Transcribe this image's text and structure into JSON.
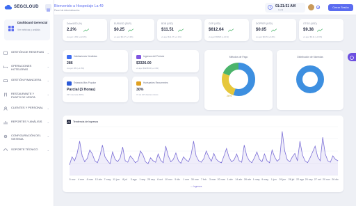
{
  "brand": {
    "name": "SEGCLOUD"
  },
  "sidebar": {
    "dashboard": {
      "title": "Dashboard Gerencial",
      "subtitle": "Ver métricas y análisis"
    },
    "items": [
      {
        "label": "GESTIÓN DE RESERVAS"
      },
      {
        "label": "OPERACIONES HOTELERAS"
      },
      {
        "label": "GESTIÓN FINANCIERA"
      },
      {
        "label": "RESTAURANTE Y PUNTO DE VENTA"
      },
      {
        "label": "CLIENTES Y PERSONAL"
      },
      {
        "label": "REPORTES Y ANÁLISIS"
      },
      {
        "label": "CONFIGURACIÓN DEL SISTEMA"
      },
      {
        "label": "SOPORTE TÉCNICO"
      }
    ]
  },
  "header": {
    "welcome": "Bienvenido a Hospedaje La 49",
    "subtitle": "Panel de Administración",
    "time": "01:21:51 AM",
    "timezone": "Local",
    "logout_label": "Cerrar Sesión"
  },
  "currency_cards": [
    {
      "label": "Dólar/USD (%)",
      "value": "2.2%",
      "sub": "vs ayer 1.8% (+22.2%)"
    },
    {
      "label": "EUR/USD (EUR)",
      "value": "$0.25",
      "sub": "vs ayer $0.27 (+7.4%)"
    },
    {
      "label": "BOB (USD)",
      "value": "$11.51",
      "sub": "vs ayer $11.27 (+2.1%)"
    },
    {
      "label": "COP (USD)",
      "value": "$612.64",
      "sub": "vs ayer $599.8 (+2.1%)"
    },
    {
      "label": "DOPPER (USD)",
      "value": "$0.05",
      "sub": "vs ayer $0.05 (+3.2%)"
    },
    {
      "label": "OTGO (USD)",
      "value": "$9.38",
      "sub": "vs ayer $9.11 (+3.0%)"
    }
  ],
  "kpis": [
    {
      "label": "Habitaciones Vendidas",
      "value": "286",
      "sub": "vs ayer 281 (+1.8%)",
      "color": "#3d6cf0"
    },
    {
      "label": "Ingresos del Periodo",
      "value": "$3326.00",
      "sub": "vs ayer $3248.00 (+2.4%)",
      "color": "#7f55e0"
    },
    {
      "label": "Estancia Más Popular",
      "value": "Parcial (3 Horas)",
      "sub": "197 reservas (69%)",
      "color": "#2c5bd8"
    },
    {
      "label": "Huéspedes Recurrentes",
      "value": "30%",
      "sub": "74 de 247 clientes únicos",
      "color": "#e0a020"
    }
  ],
  "donut_payment": {
    "title": "Métodos de Pago",
    "label": "26%",
    "segments": [
      {
        "name": "A",
        "value": 55,
        "color": "#3d8fe0"
      },
      {
        "name": "B",
        "value": 26,
        "color": "#e6c73a"
      },
      {
        "name": "C",
        "value": 19,
        "color": "#4bb46b"
      }
    ]
  },
  "donut_currency": {
    "title": "Distribución de Monedas",
    "segments": [
      {
        "name": "A",
        "value": 100,
        "color": "#3d8fe0"
      }
    ]
  },
  "chart_data": {
    "type": "line",
    "title": "Tendencia de Ingresos",
    "x": [
      "3 nov",
      "7 nov",
      "11 nov",
      "15 nov",
      "19 nov",
      "23 nov",
      "27 nov",
      "1 dic",
      "5 dic",
      "9 dic",
      "13 dic",
      "17 dic",
      "21 dic",
      "25 dic",
      "29 dic",
      "2 ene",
      "6 ene",
      "10 ene",
      "14 ene",
      "18 ene",
      "22 ene",
      "26 ene",
      "30 ene",
      "3 feb",
      "7 feb",
      "11 feb",
      "15 feb",
      "19 feb",
      "23 feb",
      "27 feb",
      "3 mar",
      "7 mar",
      "11 mar",
      "15 mar",
      "19 mar",
      "23 mar",
      "27 mar",
      "31 mar",
      "4 abr",
      "8 abr",
      "12 abr",
      "16 abr",
      "20 abr",
      "24 abr",
      "28 abr",
      "2 may",
      "6 may",
      "10 may",
      "14 may",
      "18 may",
      "22 may",
      "26 may",
      "30 may",
      "3 jun",
      "7 jun",
      "11 jun",
      "15 jun",
      "19 jun",
      "23 jun",
      "27 jun",
      "1 jul",
      "5 jul",
      "9 jul",
      "13 jul",
      "17 jul",
      "21 jul",
      "25 jul",
      "29 jul",
      "2 ago",
      "6 ago",
      "10 ago",
      "14 ago",
      "18 ago",
      "22 ago",
      "26 ago",
      "30 ago",
      "3 sep",
      "7 sep",
      "11 sep",
      "15 sep",
      "19 sep",
      "23 sep",
      "27 sep",
      "1 oct",
      "5 oct",
      "9 oct",
      "13 oct",
      "17 oct",
      "21 oct",
      "25 oct",
      "29 oct",
      "2 nov",
      "6 nov",
      "10 nov",
      "14 nov",
      "18 nov",
      "22 nov",
      "26 nov",
      "30 nov",
      "4 dic",
      "8 dic",
      "12 dic",
      "16 dic",
      "20 dic",
      "24 dic",
      "28 dic"
    ],
    "xticks": [
      "5 nov",
      "4 ene",
      "8 mar",
      "13 abr",
      "7 may",
      "11 jun",
      "8 jul",
      "3 ago",
      "1 sep",
      "25 sep",
      "6 oct",
      "10 nov",
      "5 dic",
      "1 ene",
      "30 ene",
      "7 feb",
      "3 mar",
      "20 mar",
      "1 abr",
      "14 abr",
      "28 abr",
      "1 may",
      "9 may",
      "1 jun",
      "29 jun",
      "28 jul",
      "22 ago",
      "20 sep",
      "27 oct",
      "20 nov",
      "26 dic"
    ],
    "series": [
      {
        "name": "Ingresos",
        "color": "#7b6fd6",
        "values": [
          22,
          38,
          30,
          45,
          70,
          40,
          28,
          35,
          52,
          44,
          30,
          26,
          40,
          62,
          38,
          30,
          24,
          48,
          33,
          28,
          36,
          58,
          30,
          27,
          40,
          34,
          26,
          30,
          50,
          42,
          28,
          24,
          36,
          30,
          27,
          44,
          31,
          26,
          60,
          40,
          28,
          33,
          46,
          30,
          25,
          38,
          32,
          28,
          42,
          70,
          40,
          30,
          27,
          34,
          50,
          38,
          29,
          45,
          33,
          28,
          26,
          40,
          55,
          37,
          28,
          32,
          44,
          30,
          27,
          62,
          40,
          30,
          26,
          36,
          48,
          33,
          28,
          44,
          30,
          26,
          52,
          38,
          29,
          34,
          90,
          50,
          32,
          28,
          38,
          45,
          30,
          70,
          42,
          30,
          26,
          36,
          48,
          60,
          38,
          30,
          78,
          44,
          30,
          27,
          40,
          33,
          30
        ]
      }
    ],
    "ylim": [
      0,
      100
    ],
    "legend": "bottom-center"
  }
}
